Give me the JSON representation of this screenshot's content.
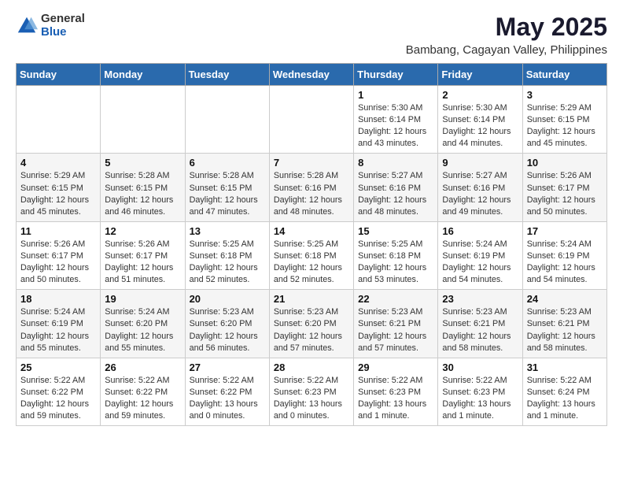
{
  "logo": {
    "general": "General",
    "blue": "Blue"
  },
  "title": "May 2025",
  "subtitle": "Bambang, Cagayan Valley, Philippines",
  "weekdays": [
    "Sunday",
    "Monday",
    "Tuesday",
    "Wednesday",
    "Thursday",
    "Friday",
    "Saturday"
  ],
  "weeks": [
    [
      {
        "day": "",
        "info": ""
      },
      {
        "day": "",
        "info": ""
      },
      {
        "day": "",
        "info": ""
      },
      {
        "day": "",
        "info": ""
      },
      {
        "day": "1",
        "info": "Sunrise: 5:30 AM\nSunset: 6:14 PM\nDaylight: 12 hours\nand 43 minutes."
      },
      {
        "day": "2",
        "info": "Sunrise: 5:30 AM\nSunset: 6:14 PM\nDaylight: 12 hours\nand 44 minutes."
      },
      {
        "day": "3",
        "info": "Sunrise: 5:29 AM\nSunset: 6:15 PM\nDaylight: 12 hours\nand 45 minutes."
      }
    ],
    [
      {
        "day": "4",
        "info": "Sunrise: 5:29 AM\nSunset: 6:15 PM\nDaylight: 12 hours\nand 45 minutes."
      },
      {
        "day": "5",
        "info": "Sunrise: 5:28 AM\nSunset: 6:15 PM\nDaylight: 12 hours\nand 46 minutes."
      },
      {
        "day": "6",
        "info": "Sunrise: 5:28 AM\nSunset: 6:15 PM\nDaylight: 12 hours\nand 47 minutes."
      },
      {
        "day": "7",
        "info": "Sunrise: 5:28 AM\nSunset: 6:16 PM\nDaylight: 12 hours\nand 48 minutes."
      },
      {
        "day": "8",
        "info": "Sunrise: 5:27 AM\nSunset: 6:16 PM\nDaylight: 12 hours\nand 48 minutes."
      },
      {
        "day": "9",
        "info": "Sunrise: 5:27 AM\nSunset: 6:16 PM\nDaylight: 12 hours\nand 49 minutes."
      },
      {
        "day": "10",
        "info": "Sunrise: 5:26 AM\nSunset: 6:17 PM\nDaylight: 12 hours\nand 50 minutes."
      }
    ],
    [
      {
        "day": "11",
        "info": "Sunrise: 5:26 AM\nSunset: 6:17 PM\nDaylight: 12 hours\nand 50 minutes."
      },
      {
        "day": "12",
        "info": "Sunrise: 5:26 AM\nSunset: 6:17 PM\nDaylight: 12 hours\nand 51 minutes."
      },
      {
        "day": "13",
        "info": "Sunrise: 5:25 AM\nSunset: 6:18 PM\nDaylight: 12 hours\nand 52 minutes."
      },
      {
        "day": "14",
        "info": "Sunrise: 5:25 AM\nSunset: 6:18 PM\nDaylight: 12 hours\nand 52 minutes."
      },
      {
        "day": "15",
        "info": "Sunrise: 5:25 AM\nSunset: 6:18 PM\nDaylight: 12 hours\nand 53 minutes."
      },
      {
        "day": "16",
        "info": "Sunrise: 5:24 AM\nSunset: 6:19 PM\nDaylight: 12 hours\nand 54 minutes."
      },
      {
        "day": "17",
        "info": "Sunrise: 5:24 AM\nSunset: 6:19 PM\nDaylight: 12 hours\nand 54 minutes."
      }
    ],
    [
      {
        "day": "18",
        "info": "Sunrise: 5:24 AM\nSunset: 6:19 PM\nDaylight: 12 hours\nand 55 minutes."
      },
      {
        "day": "19",
        "info": "Sunrise: 5:24 AM\nSunset: 6:20 PM\nDaylight: 12 hours\nand 55 minutes."
      },
      {
        "day": "20",
        "info": "Sunrise: 5:23 AM\nSunset: 6:20 PM\nDaylight: 12 hours\nand 56 minutes."
      },
      {
        "day": "21",
        "info": "Sunrise: 5:23 AM\nSunset: 6:20 PM\nDaylight: 12 hours\nand 57 minutes."
      },
      {
        "day": "22",
        "info": "Sunrise: 5:23 AM\nSunset: 6:21 PM\nDaylight: 12 hours\nand 57 minutes."
      },
      {
        "day": "23",
        "info": "Sunrise: 5:23 AM\nSunset: 6:21 PM\nDaylight: 12 hours\nand 58 minutes."
      },
      {
        "day": "24",
        "info": "Sunrise: 5:23 AM\nSunset: 6:21 PM\nDaylight: 12 hours\nand 58 minutes."
      }
    ],
    [
      {
        "day": "25",
        "info": "Sunrise: 5:22 AM\nSunset: 6:22 PM\nDaylight: 12 hours\nand 59 minutes."
      },
      {
        "day": "26",
        "info": "Sunrise: 5:22 AM\nSunset: 6:22 PM\nDaylight: 12 hours\nand 59 minutes."
      },
      {
        "day": "27",
        "info": "Sunrise: 5:22 AM\nSunset: 6:22 PM\nDaylight: 13 hours\nand 0 minutes."
      },
      {
        "day": "28",
        "info": "Sunrise: 5:22 AM\nSunset: 6:23 PM\nDaylight: 13 hours\nand 0 minutes."
      },
      {
        "day": "29",
        "info": "Sunrise: 5:22 AM\nSunset: 6:23 PM\nDaylight: 13 hours\nand 1 minute."
      },
      {
        "day": "30",
        "info": "Sunrise: 5:22 AM\nSunset: 6:23 PM\nDaylight: 13 hours\nand 1 minute."
      },
      {
        "day": "31",
        "info": "Sunrise: 5:22 AM\nSunset: 6:24 PM\nDaylight: 13 hours\nand 1 minute."
      }
    ]
  ]
}
